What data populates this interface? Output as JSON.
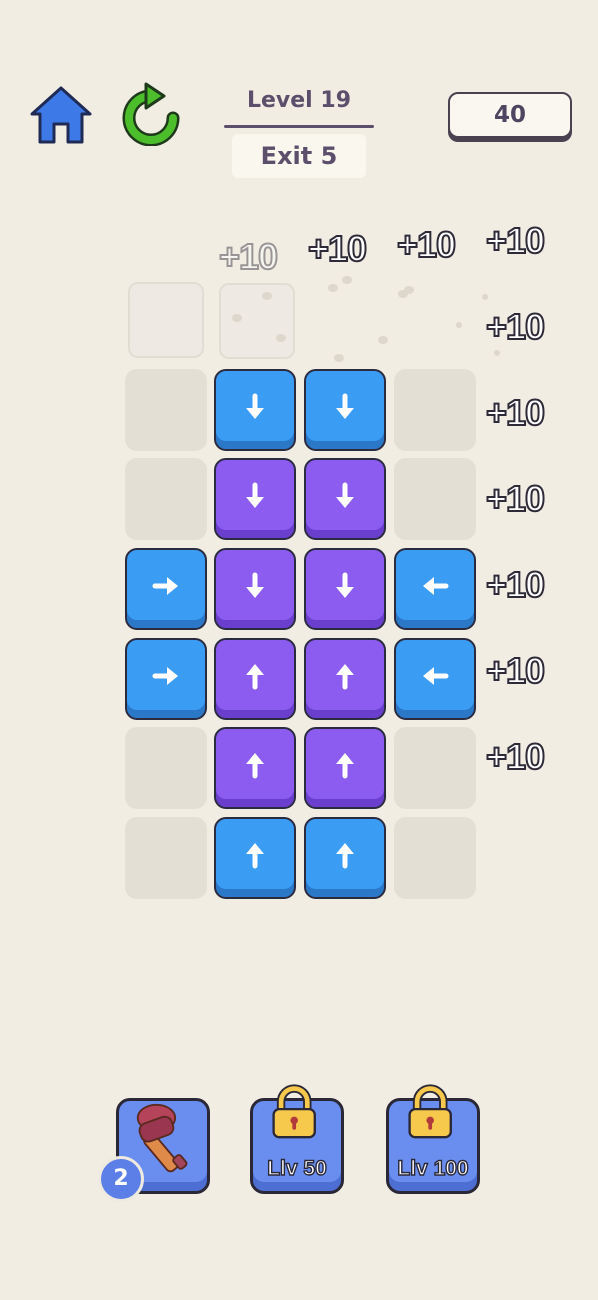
{
  "header": {
    "home_icon": "home-icon",
    "restart_icon": "restart-icon",
    "level_label": "Level 19",
    "exit_label": "Exit 5",
    "score": "40"
  },
  "popups": {
    "plus_label": "+10"
  },
  "board": {
    "rows": [
      [
        "empty",
        "down-blue",
        "down-blue",
        "empty"
      ],
      [
        "empty",
        "down-purple",
        "down-purple",
        "empty"
      ],
      [
        "right-blue",
        "down-purple",
        "down-purple",
        "left-blue"
      ],
      [
        "right-blue",
        "up-purple",
        "up-purple",
        "left-blue"
      ],
      [
        "empty",
        "up-purple",
        "up-purple",
        "empty"
      ],
      [
        "empty",
        "up-blue",
        "up-blue",
        "empty"
      ]
    ]
  },
  "boosters": {
    "hammer_icon": "hammer-icon",
    "hammer_count": "2",
    "lock_icon": "padlock-icon",
    "lock1_label": "Llv 50",
    "lock2_label": "Llv 100"
  },
  "colors": {
    "background": "#f1ede3",
    "blue_tile": "#3a9cf3",
    "purple_tile": "#8c5cf1",
    "booster": "#6a8ef0",
    "restart_green": "#4cbe2c",
    "home_blue": "#3d7ae8"
  }
}
